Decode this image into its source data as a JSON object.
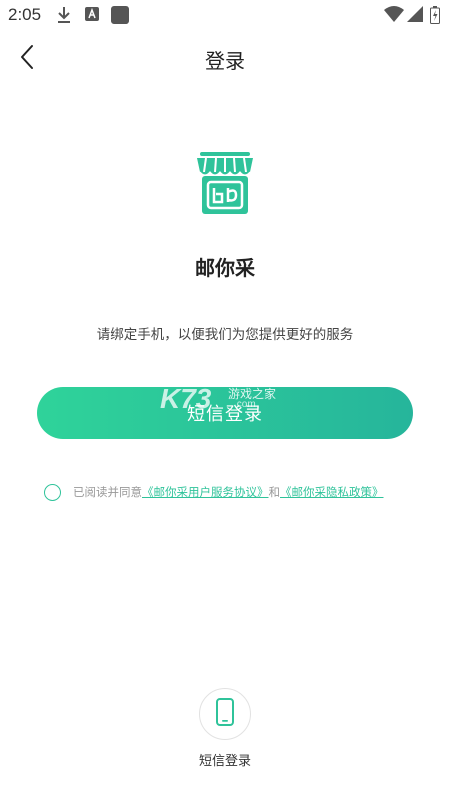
{
  "status_bar": {
    "time": "2:05",
    "icons": [
      "download-icon",
      "app-notification-icon",
      "square-notification-icon",
      "wifi-icon",
      "signal-icon",
      "battery-icon"
    ]
  },
  "header": {
    "back_icon": "chevron-left-icon",
    "title": "登录"
  },
  "app": {
    "logo_icon": "shop-logo-icon",
    "logo_color": "#2fc39a",
    "name": "邮你采",
    "subtitle": "请绑定手机，以便我们为您提供更好的服务"
  },
  "login_button": {
    "label": "短信登录",
    "gradient_start": "#2fd39a",
    "gradient_end": "#26b59b"
  },
  "watermark": {
    "brand": "K73",
    "text": "游戏之家",
    "domain": ".com"
  },
  "agreement": {
    "prefix": "已阅读并同意",
    "user_agreement": "《邮你采用户服务协议》",
    "connector": "和",
    "privacy_policy": "《邮你采隐私政策》",
    "accent_color": "#2fc39a"
  },
  "bottom_option": {
    "icon": "phone-icon",
    "label": "短信登录"
  }
}
